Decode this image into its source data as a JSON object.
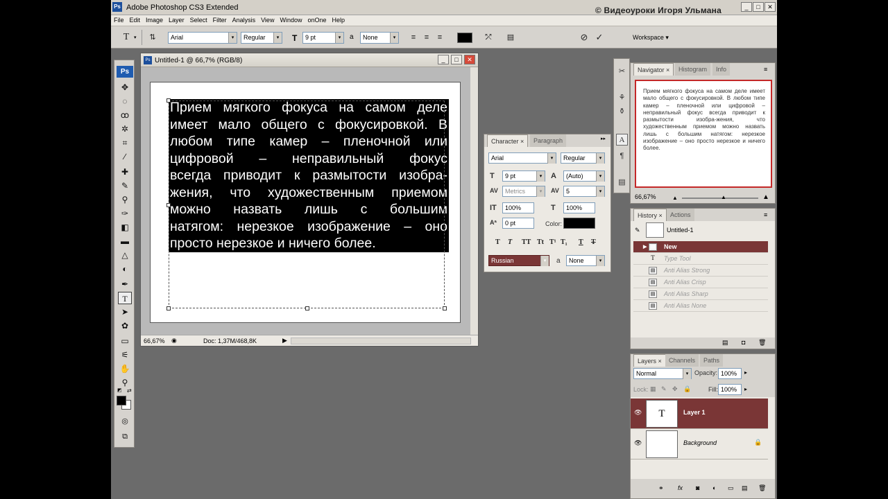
{
  "app": {
    "title": "Adobe Photoshop CS3 Extended",
    "icon_label": "Ps",
    "watermark": "© Видеоуроки Игоря Ульмана"
  },
  "menu": [
    "File",
    "Edit",
    "Image",
    "Layer",
    "Select",
    "Filter",
    "Analysis",
    "View",
    "Window",
    "onOne",
    "Help"
  ],
  "options_bar": {
    "font_family": "Arial",
    "font_style": "Regular",
    "font_size": "9 pt",
    "aa_label": "a",
    "antialias": "None",
    "workspace_label": "Workspace ▾"
  },
  "document": {
    "title": "Untitled-1 @ 66,7% (RGB/8)",
    "text_lines": [
      "Прием мягкого фокуса на самом деле",
      "имеет мало общего с фокусировкой. В",
      "любом типе камер – пленочной или",
      "цифровой – неправильный фокус",
      "всегда приводит к размытости изобра-",
      "жения, что художественным приемом",
      "можно назвать лишь с большим",
      "натягом: нерезкое изображение – оно",
      "просто нерезкое и ничего более."
    ],
    "zoom": "66,67%",
    "doc_size": "Doc: 1,37M/468,8K"
  },
  "character_panel": {
    "tabs": [
      "Character",
      "Paragraph"
    ],
    "font_family": "Arial",
    "font_style": "Regular",
    "size": "9 pt",
    "leading": "(Auto)",
    "kerning": "Metrics",
    "tracking": "5",
    "vertical_scale": "100%",
    "horizontal_scale": "100%",
    "baseline_shift": "0 pt",
    "color_label": "Color:",
    "text_color": "#000000",
    "style_buttons": [
      "T",
      "T",
      "TT",
      "Tt",
      "T¹",
      "T₁",
      "T",
      "T"
    ],
    "language": "Russian",
    "antialias": "None",
    "aa_label": "a"
  },
  "navigator_panel": {
    "tabs": [
      "Navigator",
      "Histogram",
      "Info"
    ],
    "preview_text": "Прием мягкого фокуса на самом деле имеет мало общего с фокусировкой. В любом типе камер – пленочной или цифровой – неправильный фокус всегда приводит к размытости изобра-жения, что художественным приемом можно назвать лишь с большим натягом: нерезкое изображение – оно просто нерезкое и ничего более.",
    "zoom": "66,67%"
  },
  "history_panel": {
    "tabs": [
      "History",
      "Actions"
    ],
    "snapshot": "Untitled-1",
    "items": [
      {
        "label": "New",
        "state": "selected"
      },
      {
        "label": "Type Tool",
        "state": "undone"
      },
      {
        "label": "Anti Alias Strong",
        "state": "undone"
      },
      {
        "label": "Anti Alias Crisp",
        "state": "undone"
      },
      {
        "label": "Anti Alias Sharp",
        "state": "undone"
      },
      {
        "label": "Anti Alias None",
        "state": "undone"
      }
    ]
  },
  "layers_panel": {
    "tabs": [
      "Layers",
      "Channels",
      "Paths"
    ],
    "blend_mode": "Normal",
    "opacity_label": "Opacity:",
    "opacity": "100%",
    "lock_label": "Lock:",
    "fill_label": "Fill:",
    "fill": "100%",
    "layers": [
      {
        "name": "Layer 1",
        "thumb": "T",
        "selected": true
      },
      {
        "name": "Background",
        "thumb": "",
        "selected": false
      }
    ]
  },
  "colors": {
    "selection": "#7a3636",
    "workspace_bg": "#6b6b6b",
    "panel_bg": "#d6d3ce"
  }
}
